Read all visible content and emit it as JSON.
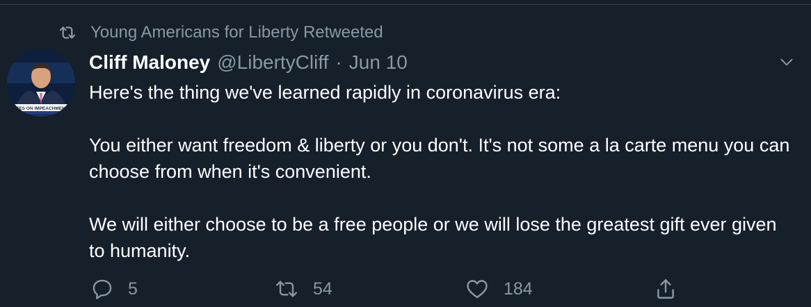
{
  "social_context": {
    "text": "Young Americans for Liberty Retweeted",
    "icon": "retweet-icon"
  },
  "author": {
    "display_name": "Cliff Maloney",
    "handle": "@LibertyCliff",
    "separator": "·",
    "date": "Jun 10",
    "avatar_caption": "VOTES ON IMPEACHMENT A"
  },
  "tweet": {
    "paragraphs": [
      "Here's the thing we've learned rapidly in coronavirus era:",
      "You either want freedom & liberty or you don't. It's not some a la carte menu you can choose from when it's convenient.",
      "We will either choose to be a free people or we will lose the greatest gift ever given to humanity."
    ]
  },
  "actions": {
    "reply_count": "5",
    "retweet_count": "54",
    "like_count": "184"
  },
  "colors": {
    "background": "#15202b",
    "text_primary": "#ffffff",
    "text_secondary": "#8899a6",
    "divider": "#38444d"
  }
}
